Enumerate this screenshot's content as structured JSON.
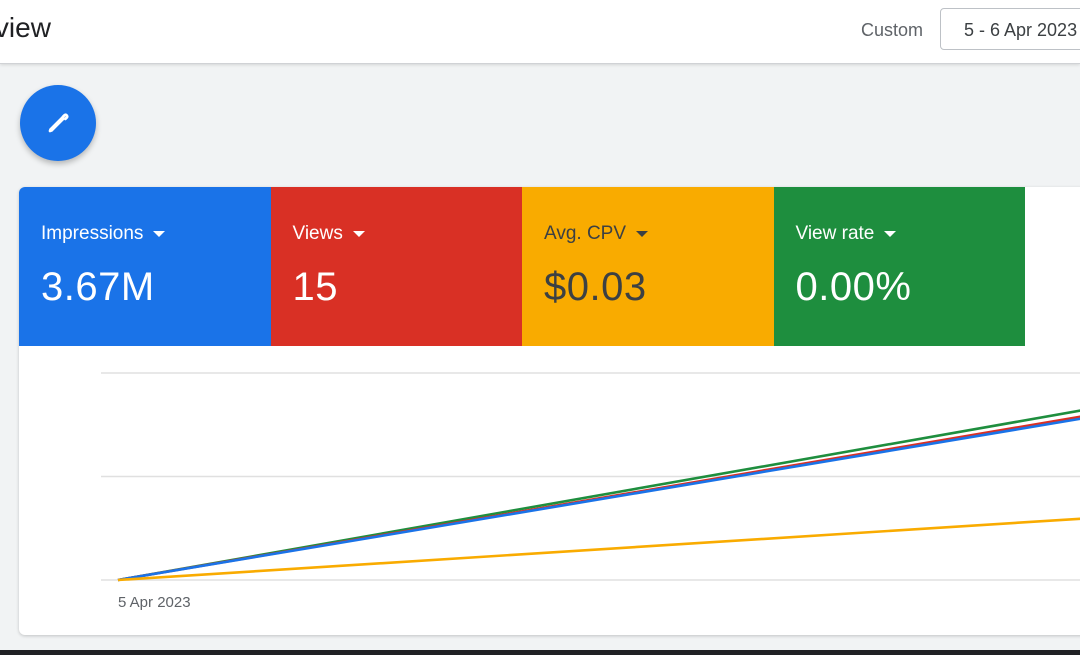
{
  "header": {
    "title": "erview",
    "custom_label": "Custom",
    "date_range": "5 - 6 Apr 2023"
  },
  "fab": {
    "icon": "pencil-icon"
  },
  "metrics": [
    {
      "label": "Impressions",
      "value": "3.67M",
      "color": "#1a73e8"
    },
    {
      "label": "Views",
      "value": "15",
      "color": "#d93025"
    },
    {
      "label": "Avg. CPV",
      "value": "$0.03",
      "color": "#f9ab00"
    },
    {
      "label": "View rate",
      "value": "0.00%",
      "color": "#1e8e3e"
    }
  ],
  "chart_data": {
    "type": "line",
    "x_tick_labels": [
      "5 Apr 2023"
    ],
    "grid": true,
    "series": [
      {
        "color": "#1e8e3e",
        "points": [
          [
            0,
            0
          ],
          [
            1,
            0.83
          ]
        ]
      },
      {
        "color": "#d93025",
        "points": [
          [
            0,
            0
          ],
          [
            1,
            0.8
          ]
        ]
      },
      {
        "color": "#1a73e8",
        "points": [
          [
            0,
            0
          ],
          [
            1,
            0.79
          ]
        ]
      },
      {
        "color": "#f9ab00",
        "points": [
          [
            0,
            0
          ],
          [
            1,
            0.3
          ]
        ]
      }
    ]
  }
}
